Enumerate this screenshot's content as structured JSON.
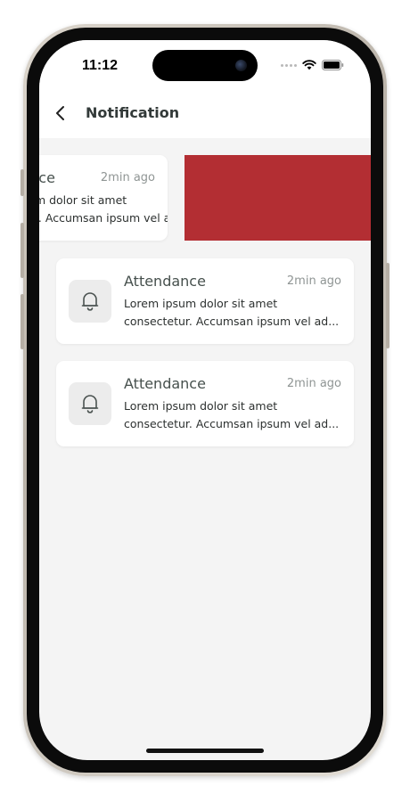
{
  "status_bar": {
    "time": "11:12",
    "icons": [
      "signal-dots",
      "wifi-icon",
      "battery-icon"
    ]
  },
  "header": {
    "back_icon": "chevron-left-icon",
    "title": "Notification"
  },
  "notifications": [
    {
      "title": "Attendance",
      "time": "2min ago",
      "line1": "Lorem ipsum dolor sit amet",
      "line2": "consectetur. Accumsan ipsum vel ad...",
      "icon": "bell-icon",
      "state": "swiped-left"
    },
    {
      "title": "Attendance",
      "time": "2min ago",
      "line1": "Lorem ipsum dolor sit amet",
      "line2": "consectetur. Accumsan ipsum vel ad...",
      "icon": "bell-icon"
    },
    {
      "title": "Attendance",
      "time": "2min ago",
      "line1": "Lorem ipsum dolor sit amet",
      "line2": "consectetur. Accumsan ipsum vel ad...",
      "icon": "bell-icon"
    }
  ],
  "swipe_action": {
    "color": "#b32e33"
  },
  "colors": {
    "screen_bg": "#f4f4f4",
    "card_bg": "#ffffff",
    "icon_box_bg": "#ececec",
    "title_text": "#46504d",
    "meta_text": "#8f9594",
    "delete_red": "#b32e33"
  }
}
